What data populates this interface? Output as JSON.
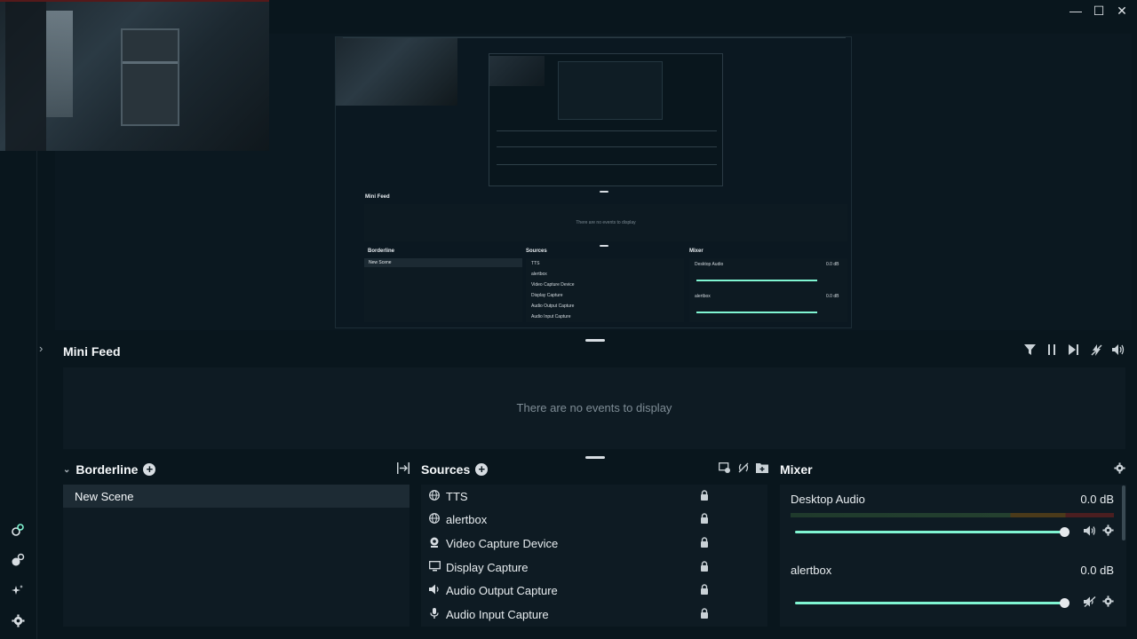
{
  "window": {
    "controls": {
      "minimize": "—",
      "maximize": "☐",
      "close": "✕"
    }
  },
  "rail": {
    "icons": [
      "studio-mode-icon",
      "dual-output-icon",
      "effects-icon",
      "settings-icon"
    ]
  },
  "preview": {
    "mini": {
      "feed_title": "Mini Feed",
      "feed_empty": "There are no events to display",
      "scenes_title": "Borderline",
      "scene_selected": "New Scene",
      "sources_title": "Sources",
      "mixer_title": "Mixer",
      "sources": [
        "TTS",
        "alertbox",
        "Video Capture Device",
        "Display Capture",
        "Audio Output Capture",
        "Audio Input Capture"
      ],
      "mixer": [
        {
          "name": "Desktop Audio",
          "db": "0.0 dB"
        },
        {
          "name": "alertbox",
          "db": "0.0 dB"
        }
      ]
    }
  },
  "mini_feed": {
    "title": "Mini Feed",
    "empty_text": "There are no events to display",
    "tools": {
      "filter": "⏷",
      "pause": "∥",
      "skip": "⏭",
      "mute_alerts": "⚡",
      "volume": "🔊"
    }
  },
  "scenes": {
    "title": "Borderline",
    "items": [
      {
        "label": "New Scene",
        "selected": true
      }
    ]
  },
  "sources": {
    "title": "Sources",
    "items": [
      {
        "label": "TTS",
        "icon": "globe-icon"
      },
      {
        "label": "alertbox",
        "icon": "globe-icon"
      },
      {
        "label": "Video Capture Device",
        "icon": "webcam-icon"
      },
      {
        "label": "Display Capture",
        "icon": "monitor-icon"
      },
      {
        "label": "Audio Output Capture",
        "icon": "speaker-icon"
      },
      {
        "label": "Audio Input Capture",
        "icon": "microphone-icon"
      }
    ]
  },
  "mixer": {
    "title": "Mixer",
    "items": [
      {
        "name": "Desktop Audio",
        "db": "0.0 dB",
        "volume": 1.0,
        "muted": false
      },
      {
        "name": "alertbox",
        "db": "0.0 dB",
        "volume": 1.0,
        "muted": true
      }
    ]
  },
  "colors": {
    "background": "#09161d",
    "panel": "#0e1b23",
    "accent": "#80f5d2",
    "selected": "#1d2b34"
  }
}
